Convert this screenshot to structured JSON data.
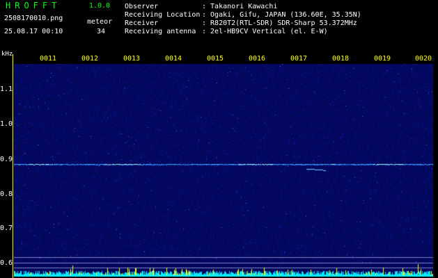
{
  "app": {
    "name": "HROFFT",
    "version": "1.0.0",
    "file_name": "2508170010.png",
    "datetime": "25.08.17 00:10",
    "meteor_label": "meteor",
    "meteor_count": "34"
  },
  "header": {
    "rows": [
      {
        "label": "Observer",
        "value": ": Takanori Kawachi"
      },
      {
        "label": "Receiving Location",
        "value": ": Ogaki, Gifu, JAPAN (136.60E, 35.35N)"
      },
      {
        "label": "Receiver",
        "value": ": R820T2(RTL-SDR) SDR-Sharp 53.372MHz"
      },
      {
        "label": "Receiving antenna",
        "value": ": 2el-HB9CV Vertical (el. E-W)"
      }
    ]
  },
  "axes": {
    "y_unit": "kHz",
    "y_ticks": [
      "1.1",
      "1.0",
      "0.9",
      "0.8",
      "0.7",
      "0.6"
    ],
    "x_ticks": [
      "0011",
      "0012",
      "0013",
      "0014",
      "0015",
      "0016",
      "0017",
      "0018",
      "0019",
      "0020"
    ]
  },
  "colors": {
    "background": "#000000",
    "plot_bg": "#04086a",
    "title_green": "#00ff00",
    "axis_yellow": "#ffff00",
    "trace_cyan": "#00ffff"
  }
}
